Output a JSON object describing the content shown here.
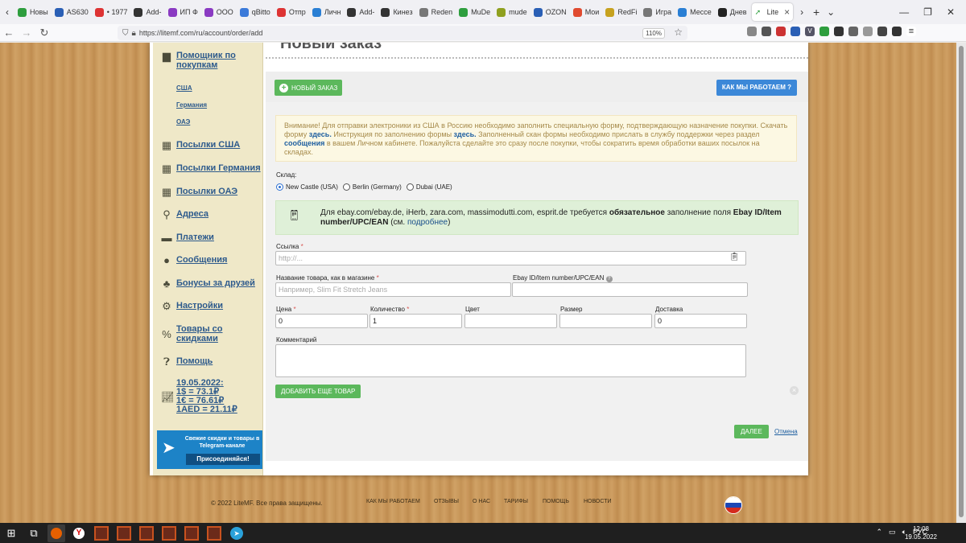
{
  "browser": {
    "tabs": [
      {
        "label": "Новы",
        "color": "#2e9e3e"
      },
      {
        "label": "AS630",
        "color": "#2a5fb5"
      },
      {
        "label": "• 1977",
        "color": "#d33"
      },
      {
        "label": "Add-",
        "color": "#333"
      },
      {
        "label": "ИП Ф",
        "color": "#8a3ac2"
      },
      {
        "label": "ООО",
        "color": "#8a3ac2"
      },
      {
        "label": "qBitto",
        "color": "#3b7ad9"
      },
      {
        "label": "Отпр",
        "color": "#d33"
      },
      {
        "label": "Личн",
        "color": "#2a7fd4"
      },
      {
        "label": "Add-",
        "color": "#333"
      },
      {
        "label": "Кинез",
        "color": "#333"
      },
      {
        "label": "Reden",
        "color": "#777"
      },
      {
        "label": "MuDe",
        "color": "#2e9e3e"
      },
      {
        "label": "mude",
        "color": "#8fa01f"
      },
      {
        "label": "OZON",
        "color": "#2a5fb5"
      },
      {
        "label": "Мои",
        "color": "#e04a2f"
      },
      {
        "label": "RedFi",
        "color": "#c7a21f"
      },
      {
        "label": "Игра",
        "color": "#777"
      },
      {
        "label": "Мессе",
        "color": "#2a7fd4"
      },
      {
        "label": "Днев",
        "color": "#222"
      }
    ],
    "active_tab": "Lite",
    "url": "https://litemf.com/ru/account/order/add",
    "zoom": "110%"
  },
  "sidebar": {
    "assistant_label": "Помощник по покупкам",
    "sublinks": [
      "США",
      "Германия",
      "ОАЭ"
    ],
    "items": [
      {
        "label": "Посылки США",
        "icon": "grid-icon"
      },
      {
        "label": "Посылки Германия",
        "icon": "grid-icon"
      },
      {
        "label": "Посылки ОАЭ",
        "icon": "grid-icon"
      },
      {
        "label": "Адреса",
        "icon": "pin-icon"
      },
      {
        "label": "Платежи",
        "icon": "card-icon"
      },
      {
        "label": "Сообщения",
        "icon": "chat-icon"
      },
      {
        "label": "Бонусы за друзей",
        "icon": "people-icon"
      },
      {
        "label": "Настройки",
        "icon": "gear-icon"
      },
      {
        "label": "Товары со скидками",
        "icon": "percent-icon"
      },
      {
        "label": "Помощь",
        "icon": "question-icon"
      }
    ],
    "rates": {
      "date": "19.05.2022:",
      "usd": "1$ = 73.1₽",
      "eur": "1€ = 76.61₽",
      "aed": "1AED = 21.11₽"
    },
    "telegram": {
      "text": "Свежие скидки и товары в Telegram-канале",
      "button": "Присоединяйся!"
    }
  },
  "main": {
    "title": "Новый заказ",
    "new_order_button": "НОВЫЙ ЗАКАЗ",
    "how_button": "КАК МЫ РАБОТАЕМ ?",
    "alert": {
      "p1": "Внимание! Для отправки электроники из США в Россию необходимо заполнить специальную форму, подтверждающую назначение покупки. Скачать форму ",
      "link1": "здесь.",
      "p2": " Инструкция по заполнению формы ",
      "link2": "здесь.",
      "p3": " Заполненный скан формы необходимо прислать в службу поддержки через раздел ",
      "link3": "сообщения",
      "p4": " в вашем Личном кабинете. Пожалуйста сделайте это сразу после покупки, чтобы сократить время обработки ваших посылок на складах."
    },
    "warehouse_label": "Склад:",
    "warehouses": [
      "New Castle (USA)",
      "Berlin (Germany)",
      "Dubai (UAE)"
    ],
    "note": {
      "p1": "Для ebay.com/ebay.de, iHerb, zara.com, massimodutti.com, esprit.de требуется ",
      "bold1": "обязательное",
      "p2": " заполнение поля ",
      "bold2": "Ebay ID/Item number/UPC/EAN",
      "p3": " (см. ",
      "link": "подробнее",
      "p4": ")"
    },
    "fields": {
      "link_label": "Ссылка",
      "link_placeholder": "http://...",
      "name_label": "Название товара, как в магазине",
      "name_placeholder": "Например, Slim Fit Stretch Jeans",
      "ebay_label": "Ebay ID/Item number/UPC/EAN",
      "price_label": "Цена",
      "price_value": "0",
      "qty_label": "Количество",
      "qty_value": "1",
      "color_label": "Цвет",
      "size_label": "Размер",
      "delivery_label": "Доставка",
      "delivery_value": "0",
      "comment_label": "Комментарий",
      "required_mark": "*"
    },
    "add_more_button": "ДОБАВИТЬ ЕЩЕ ТОВАР",
    "next_button": "ДАЛЕЕ",
    "cancel_link": "Отмена"
  },
  "footer": {
    "copyright": "© 2022 LiteMF. Все права защищены.",
    "links": [
      "КАК МЫ РАБОТАЕМ",
      "ОТЗЫВЫ",
      "О НАС",
      "ТАРИФЫ",
      "ПОМОЩЬ",
      "НОВОСТИ"
    ]
  },
  "taskbar": {
    "lang": "РУС",
    "time": "12:08",
    "date": "19.05.2022"
  }
}
